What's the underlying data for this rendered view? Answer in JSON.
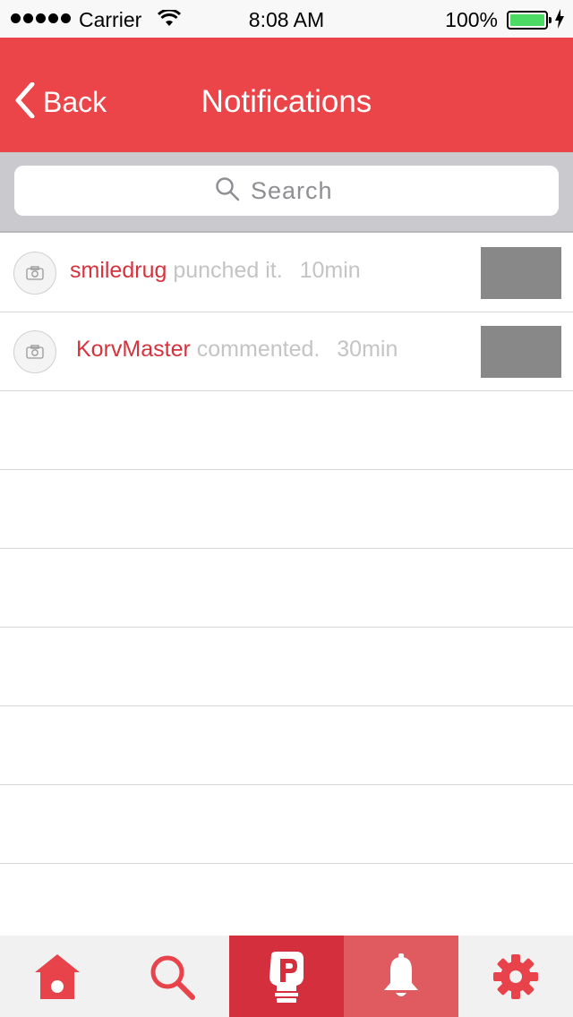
{
  "status_bar": {
    "carrier": "Carrier",
    "time": "8:08 AM",
    "battery": "100%",
    "battery_color": "#4cd964"
  },
  "nav": {
    "back_label": "Back",
    "title": "Notifications",
    "background": "#ec4549"
  },
  "search": {
    "placeholder": "Search"
  },
  "notifications": [
    {
      "user": "smiledrug",
      "action": "punched it.",
      "time": "10min"
    },
    {
      "user": "KorvMaster",
      "action": "commented.",
      "time": "30min"
    }
  ],
  "tabs": [
    {
      "icon": "home-icon",
      "active": false
    },
    {
      "icon": "search-icon",
      "active": false
    },
    {
      "icon": "punch-logo-icon",
      "active": false
    },
    {
      "icon": "bell-icon",
      "active": true
    },
    {
      "icon": "gear-icon",
      "active": false
    }
  ]
}
